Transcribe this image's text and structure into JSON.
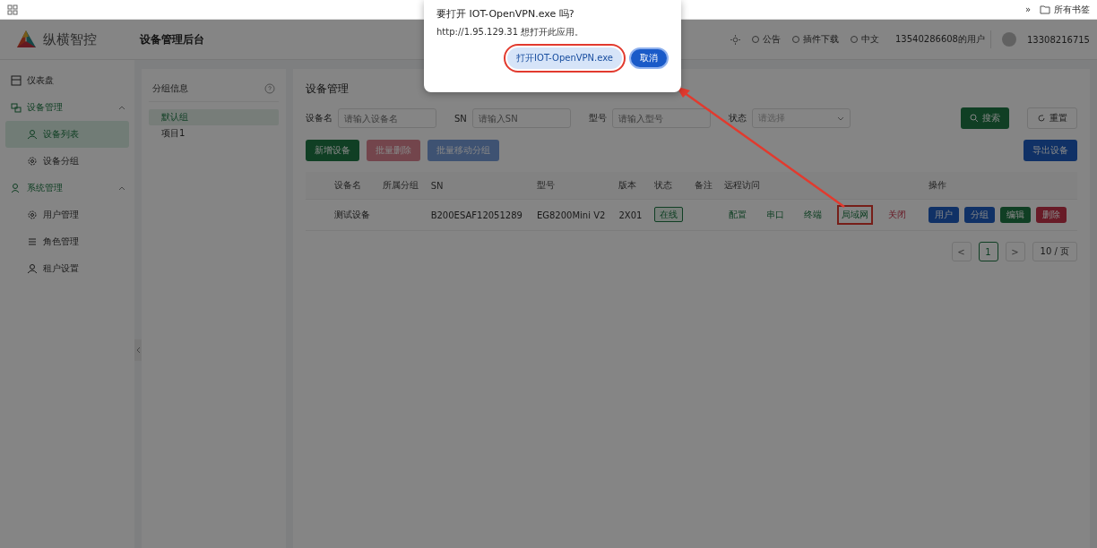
{
  "browser_bar": {
    "overflow": "»",
    "bookmarks": "所有书签"
  },
  "header": {
    "brand": "纵横智控",
    "title": "设备管理后台",
    "tools": [
      "公告",
      "插件下载",
      "中文"
    ],
    "tenant": "13540286608的用户",
    "user": "13308216715"
  },
  "sidebar": {
    "items": [
      {
        "label": "仪表盘",
        "expanded": false
      },
      {
        "label": "设备管理",
        "expanded": true,
        "children": [
          {
            "label": "设备列表",
            "selected": true
          },
          {
            "label": "设备分组",
            "selected": false
          }
        ]
      },
      {
        "label": "系统管理",
        "expanded": true,
        "children": [
          {
            "label": "用户管理",
            "selected": false
          },
          {
            "label": "角色管理",
            "selected": false
          },
          {
            "label": "租户设置",
            "selected": false
          }
        ]
      }
    ]
  },
  "groups": {
    "title": "分组信息",
    "items": [
      {
        "label": "默认组",
        "selected": true
      },
      {
        "label": "项目1",
        "selected": false
      }
    ]
  },
  "main": {
    "title": "设备管理",
    "filters": [
      {
        "label": "设备名",
        "placeholder": "请输入设备名",
        "kind": "input"
      },
      {
        "label": "SN",
        "placeholder": "请输入SN",
        "kind": "input"
      },
      {
        "label": "型号",
        "placeholder": "请输入型号",
        "kind": "input"
      },
      {
        "label": "状态",
        "placeholder": "请选择",
        "kind": "select"
      }
    ],
    "search_button": "搜索",
    "reset_button": "重置",
    "toolbar": [
      {
        "label": "新增设备",
        "kind": "success",
        "disabled": false
      },
      {
        "label": "批量删除",
        "kind": "danger",
        "disabled": true
      },
      {
        "label": "批量移动分组",
        "kind": "primary",
        "disabled": true
      }
    ],
    "export_button": "导出设备",
    "table": {
      "columns": [
        "设备名",
        "所属分组",
        "SN",
        "型号",
        "版本",
        "状态",
        "备注",
        "远程访问",
        "操作"
      ],
      "rows": [
        {
          "name": "测试设备",
          "group": "",
          "sn": "B200ESAF12051289",
          "model": "EG8200Mini V2",
          "version": "2X01",
          "status": {
            "label": "在线",
            "kind": "success"
          },
          "note": "",
          "remote": [
            {
              "label": "配置",
              "kind": "success",
              "annotated": false
            },
            {
              "label": "串口",
              "kind": "success",
              "annotated": false
            },
            {
              "label": "终端",
              "kind": "success",
              "annotated": false
            },
            {
              "label": "局域网",
              "kind": "success",
              "annotated": true
            },
            {
              "label": "关闭",
              "kind": "danger",
              "annotated": false
            }
          ],
          "actions": [
            {
              "label": "用户",
              "kind": "primary"
            },
            {
              "label": "分组",
              "kind": "primary"
            },
            {
              "label": "编辑",
              "kind": "success"
            },
            {
              "label": "删除",
              "kind": "danger"
            }
          ]
        }
      ]
    },
    "pagination": {
      "prev": "<",
      "pages": [
        {
          "label": "1",
          "selected": true
        }
      ],
      "next": ">",
      "page_size": "10 / 页"
    }
  },
  "dialog": {
    "title": "要打开 IOT-OpenVPN.exe 吗?",
    "message": "http://1.95.129.31 想打开此应用。",
    "open_button": {
      "label": "打开IOT-OpenVPN.exe",
      "annotated": true
    },
    "cancel_button": "取消"
  }
}
